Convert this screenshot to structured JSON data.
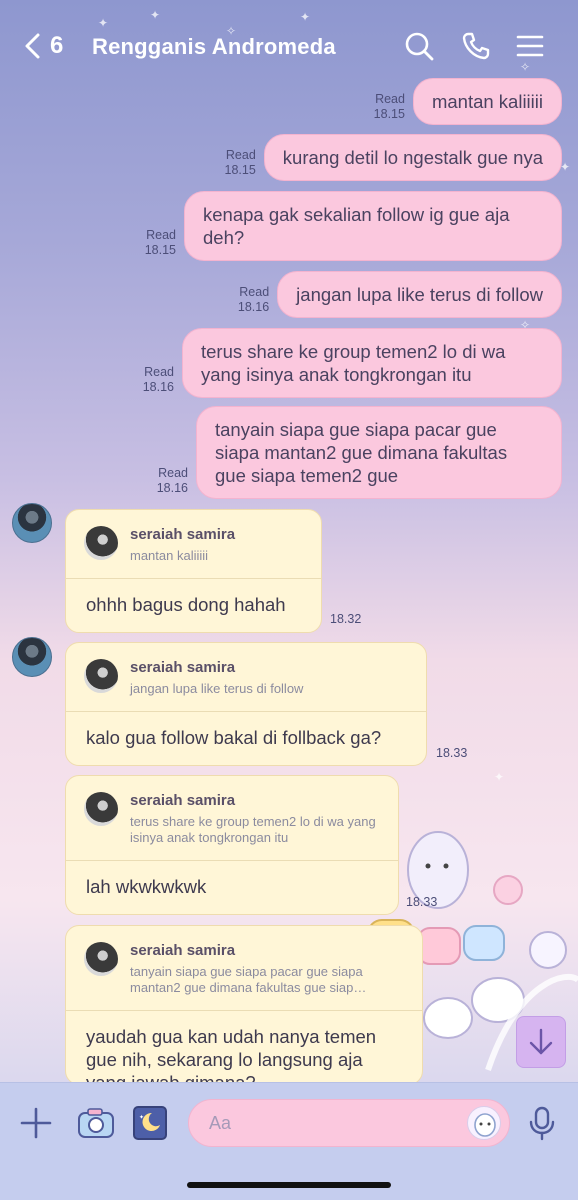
{
  "header": {
    "back_count": "6",
    "title": "Rengganis Andromeda",
    "icons": [
      "chevron-left-icon",
      "search-icon",
      "phone-icon",
      "menu-icon"
    ]
  },
  "outgoing": [
    {
      "status": "Read",
      "time": "18.15",
      "text": "mantan kaliiiii"
    },
    {
      "status": "Read",
      "time": "18.15",
      "text": "kurang detil lo ngestalk gue nya"
    },
    {
      "status": "Read",
      "time": "18.15",
      "text": "kenapa gak sekalian follow ig gue aja deh?"
    },
    {
      "status": "Read",
      "time": "18.16",
      "text": "jangan lupa like terus di follow"
    },
    {
      "status": "Read",
      "time": "18.16",
      "text": "terus share ke group temen2 lo di wa yang isinya anak tongkrongan itu"
    },
    {
      "status": "Read",
      "time": "18.16",
      "text": "tanyain siapa gue siapa pacar gue siapa mantan2 gue dimana fakultas gue siapa temen2 gue"
    }
  ],
  "incoming": [
    {
      "reply_name": "seraiah samira",
      "reply_quote": "mantan kaliiiii",
      "text": "ohhh bagus dong hahah",
      "time": "18.32"
    },
    {
      "reply_name": "seraiah samira",
      "reply_quote": "jangan lupa like terus di follow",
      "text": "kalo gua follow bakal di follback ga?",
      "time": "18.33"
    },
    {
      "reply_name": "seraiah samira",
      "reply_quote": "terus share ke group temen2 lo di wa yang isinya anak tongkrongan itu",
      "text": "lah wkwkwkwk",
      "time": "18.33"
    },
    {
      "reply_name": "seraiah samira",
      "reply_quote": "tanyain siapa gue siapa pacar gue siapa mantan2 gue dimana fakultas gue siap…",
      "text": "yaudah gua kan udah nanya temen gue nih, sekarang lo langsung aja yang jawab gimana?",
      "time": ""
    }
  ],
  "input": {
    "placeholder": "Aa",
    "icons": [
      "plus-icon",
      "camera-icon",
      "gallery-icon",
      "sticker-icon",
      "microphone-icon"
    ]
  },
  "colors": {
    "outgoing_bubble": "#fbc8de",
    "incoming_bubble": "#fff6d7",
    "input_bar": "#c5cdee",
    "scroll_button": "#d6b4f0"
  }
}
